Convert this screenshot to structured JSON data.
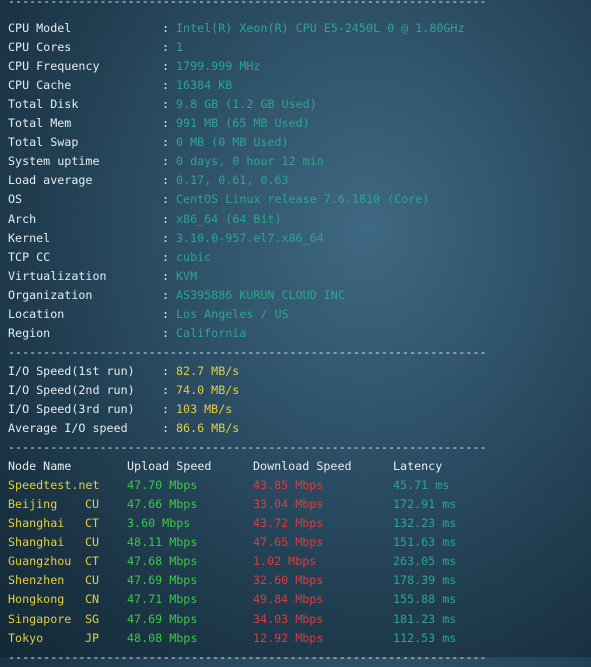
{
  "separator": "--------------------------------------------------------------------",
  "colon": ":",
  "sysinfo": [
    {
      "label": "CPU Model",
      "value": "Intel(R) Xeon(R) CPU E5-2450L 0 @ 1.80GHz"
    },
    {
      "label": "CPU Cores",
      "value": "1"
    },
    {
      "label": "CPU Frequency",
      "value": "1799.999 MHz"
    },
    {
      "label": "CPU Cache",
      "value": "16384 KB"
    },
    {
      "label": "Total Disk",
      "value": "9.8 GB (1.2 GB Used)"
    },
    {
      "label": "Total Mem",
      "value": "991 MB (65 MB Used)"
    },
    {
      "label": "Total Swap",
      "value": "0 MB (0 MB Used)"
    },
    {
      "label": "System uptime",
      "value": "0 days, 0 hour 12 min"
    },
    {
      "label": "Load average",
      "value": "0.17, 0.61, 0.63"
    },
    {
      "label": "OS",
      "value": "CentOS Linux release 7.6.1810 (Core)"
    },
    {
      "label": "Arch",
      "value": "x86_64 (64 Bit)"
    },
    {
      "label": "Kernel",
      "value": "3.10.0-957.el7.x86_64"
    },
    {
      "label": "TCP CC",
      "value": "cubic"
    },
    {
      "label": "Virtualization",
      "value": "KVM"
    },
    {
      "label": "Organization",
      "value": "AS395886 KURUN CLOUD INC"
    },
    {
      "label": "Location",
      "value": "Los Angeles / US"
    },
    {
      "label": "Region",
      "value": "California"
    }
  ],
  "io": [
    {
      "label": "I/O Speed(1st run)",
      "value": "82.7 MB/s"
    },
    {
      "label": "I/O Speed(2nd run)",
      "value": "74.0 MB/s"
    },
    {
      "label": "I/O Speed(3rd run)",
      "value": "103 MB/s"
    },
    {
      "label": "Average I/O speed",
      "value": "86.6 MB/s"
    }
  ],
  "speed_header": {
    "node": "Node Name",
    "upload": "Upload Speed",
    "download": "Download Speed",
    "latency": "Latency"
  },
  "speed_rows": [
    {
      "node": "Speedtest.net",
      "isp": "",
      "upload": "47.70 Mbps",
      "download": "43.85 Mbps",
      "latency": "45.71 ms"
    },
    {
      "node": "Beijing",
      "isp": "CU",
      "upload": "47.66 Mbps",
      "download": "33.04 Mbps",
      "latency": "172.91 ms"
    },
    {
      "node": "Shanghai",
      "isp": "CT",
      "upload": "3.60 Mbps",
      "download": "43.72 Mbps",
      "latency": "132.23 ms"
    },
    {
      "node": "Shanghai",
      "isp": "CU",
      "upload": "48.11 Mbps",
      "download": "47.65 Mbps",
      "latency": "151.63 ms"
    },
    {
      "node": "Guangzhou",
      "isp": "CT",
      "upload": "47.68 Mbps",
      "download": "1.02 Mbps",
      "latency": "263.05 ms"
    },
    {
      "node": "Shenzhen",
      "isp": "CU",
      "upload": "47.69 Mbps",
      "download": "32.60 Mbps",
      "latency": "178.39 ms"
    },
    {
      "node": "Hongkong",
      "isp": "CN",
      "upload": "47.71 Mbps",
      "download": "49.84 Mbps",
      "latency": "155.88 ms"
    },
    {
      "node": "Singapore",
      "isp": "SG",
      "upload": "47.69 Mbps",
      "download": "34.03 Mbps",
      "latency": "181.23 ms"
    },
    {
      "node": "Tokyo",
      "isp": "JP",
      "upload": "48.08 Mbps",
      "download": "12.92 Mbps",
      "latency": "112.53 ms"
    }
  ],
  "colors": {
    "value_teal": "#2ea58f",
    "io_yellow": "#e2cf3e",
    "upload_green": "#3dc846",
    "download_red": "#e03a3a"
  }
}
